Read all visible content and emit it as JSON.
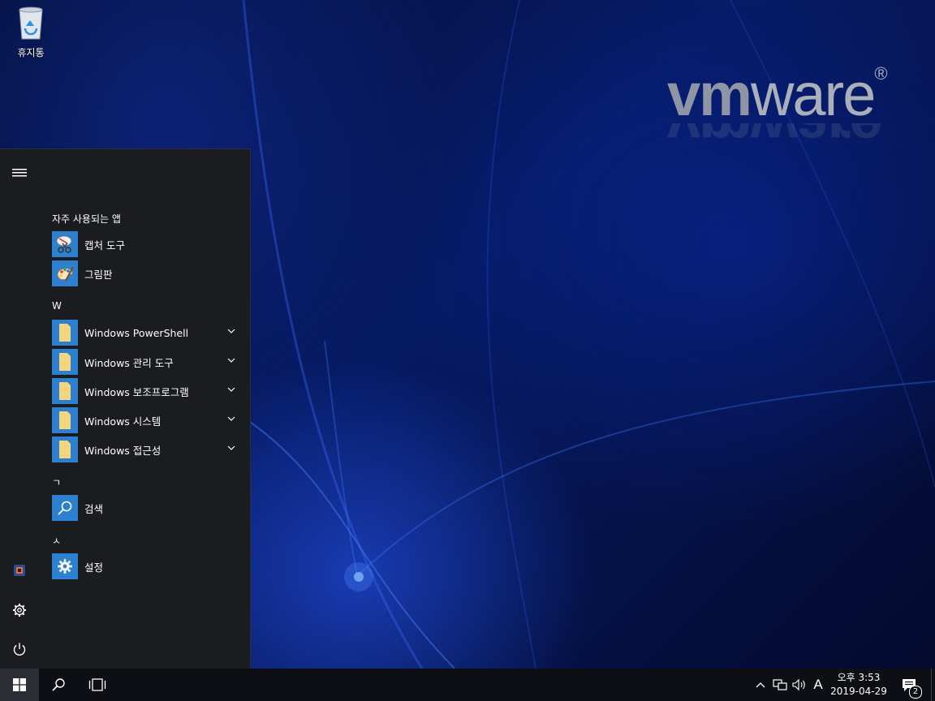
{
  "desktop": {
    "recycle_bin_label": "휴지통",
    "logo_text_bold": "vm",
    "logo_text_light": "ware",
    "logo_reg": "®"
  },
  "start_menu": {
    "sections": {
      "frequent": "자주 사용되는 앱",
      "w": "W",
      "giyeok": "ㄱ",
      "siot": "ㅅ"
    },
    "frequent_apps": [
      {
        "label": "캡처 도구",
        "icon": "snipping-tool-icon"
      },
      {
        "label": "그림판",
        "icon": "paint-icon"
      }
    ],
    "w_folders": [
      {
        "label": "Windows PowerShell",
        "icon": "folder-icon"
      },
      {
        "label": "Windows 관리 도구",
        "icon": "folder-icon"
      },
      {
        "label": "Windows 보조프로그램",
        "icon": "folder-icon"
      },
      {
        "label": "Windows 시스템",
        "icon": "folder-icon"
      },
      {
        "label": "Windows 접근성",
        "icon": "folder-icon"
      }
    ],
    "giyeok_apps": [
      {
        "label": "검색",
        "icon": "search-icon"
      }
    ],
    "siot_apps": [
      {
        "label": "설정",
        "icon": "gear-icon"
      }
    ],
    "rail_icons": [
      "hamburger-icon",
      "app-icon",
      "gear-icon",
      "power-icon"
    ]
  },
  "taskbar": {
    "clock_time": "오후 3:53",
    "clock_date": "2019-04-29",
    "ime_mode": "A",
    "notification_count": "2",
    "icons": [
      "windows-start-icon",
      "search-icon",
      "task-view-icon",
      "chevron-up-icon",
      "network-icon",
      "volume-icon",
      "action-center-icon"
    ]
  },
  "colors": {
    "tile_blue": "#2d7fd0",
    "menu_bg": "#1b1c1f",
    "taskbar_bg": "#0d0f14",
    "folder_yellow": "#f4d77c"
  }
}
